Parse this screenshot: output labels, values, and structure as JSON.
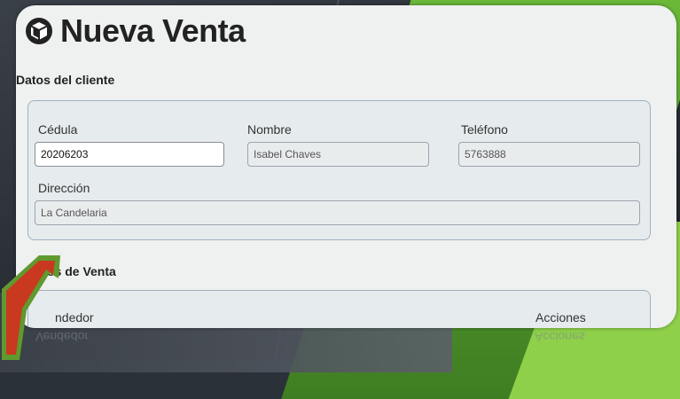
{
  "page": {
    "title": "Nueva Venta"
  },
  "cliente": {
    "section_label": "Datos del cliente",
    "cedula_label": "Cédula",
    "cedula_value": "20206203",
    "nombre_label": "Nombre",
    "nombre_value": "Isabel Chaves",
    "telefono_label": "Teléfono",
    "telefono_value": "5763888",
    "direccion_label": "Dirección",
    "direccion_value": "La Candelaria"
  },
  "venta": {
    "section_label": "os de Venta",
    "vendedor_label": "ndedor",
    "acciones_label": "Acciones",
    "reflection_vendedor": "Vendedor",
    "reflection_acciones": "Acciones"
  },
  "icons": {
    "title_icon": "box-icon",
    "pointer": "arrow-icon"
  },
  "colors": {
    "panel_bg": "#eff0f0",
    "box_border": "#9eb0bd",
    "arrow_fill": "#c8391f",
    "arrow_border": "#5f9a2e",
    "accent_green": "#6dbb3a"
  }
}
